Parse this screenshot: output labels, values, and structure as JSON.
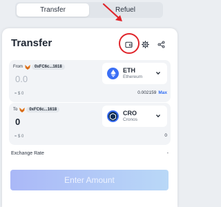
{
  "tabs": [
    {
      "label": "Transfer",
      "active": true
    },
    {
      "label": "Refuel",
      "active": false
    }
  ],
  "card": {
    "title": "Transfer"
  },
  "from": {
    "label": "From",
    "address": "0xFC6c...1618",
    "amount_placeholder": "0.0",
    "usd": "≈ $ 0",
    "token": {
      "symbol": "ETH",
      "network": "Ethereum",
      "icon": "ethereum-icon"
    },
    "balance": "0.002159",
    "max_label": "Max"
  },
  "to": {
    "label": "To",
    "address": "0xFC6c...1618",
    "amount": "0",
    "usd": "≈ $ 0",
    "token": {
      "symbol": "CRO",
      "network": "Cronos",
      "icon": "cronos-icon"
    },
    "balance": "0"
  },
  "exchange_rate": {
    "label": "Exchange Rate",
    "value": "-"
  },
  "enter_button": {
    "label": "Enter Amount"
  },
  "colors": {
    "accent": "#2f6df5",
    "highlight": "#e0242a",
    "button_gradient_start": "#aab8f7",
    "button_gradient_end": "#b9d8f7"
  }
}
